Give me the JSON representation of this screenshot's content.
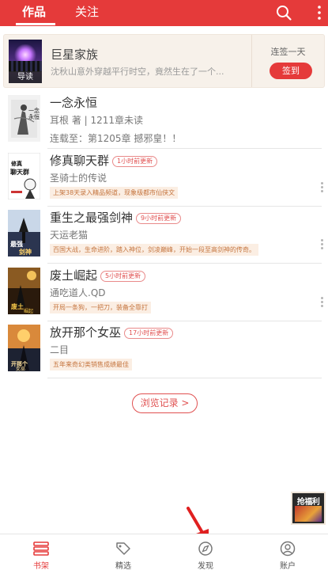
{
  "header": {
    "tabs": [
      {
        "label": "作品",
        "active": true
      },
      {
        "label": "关注",
        "active": false
      }
    ],
    "icons": [
      "search-icon",
      "more-vertical-icon"
    ],
    "color": "#e53a3a"
  },
  "banner": {
    "cover_tag": "导读",
    "title": "巨星家族",
    "description": "沈秋山意外穿越平行时空，竟然生在了一个...",
    "streak": "连签一天",
    "checkin_label": "签到"
  },
  "books": [
    {
      "title": "一念永恒",
      "badge": "",
      "author": "耳根 著 | 1211章未读",
      "note": "连载至：第1205章 撼邪皇！！",
      "promo": ""
    },
    {
      "title": "修真聊天群",
      "badge": "1小时前更新",
      "author": "圣骑士的传说",
      "note": "",
      "promo": "上架38天录入精品频道，现象级都市仙侠文"
    },
    {
      "title": "重生之最强剑神",
      "badge": "9小时前更新",
      "author": "天运老猫",
      "note": "",
      "promo": "百国大战，生命进阶，踏入神位，剑凌巅峰，开始一段至高剑神的传奇。"
    },
    {
      "title": "废土崛起",
      "badge": "5小时前更新",
      "author": "通吃道人.QD",
      "note": "",
      "promo": "开局一条狗，一把刀，装备全靠打"
    },
    {
      "title": "放开那个女巫",
      "badge": "17小时前更新",
      "author": "二目",
      "note": "",
      "promo": "五年来奇幻类销售成绩最佳"
    }
  ],
  "history_label": "浏览记录 >",
  "float_ad_text": "抢福利",
  "bottom_nav": [
    {
      "label": "书架",
      "icon": "bookshelf-icon",
      "active": true
    },
    {
      "label": "精选",
      "icon": "tag-icon",
      "active": false
    },
    {
      "label": "发现",
      "icon": "compass-icon",
      "active": false
    },
    {
      "label": "账户",
      "icon": "user-icon",
      "active": false
    }
  ]
}
